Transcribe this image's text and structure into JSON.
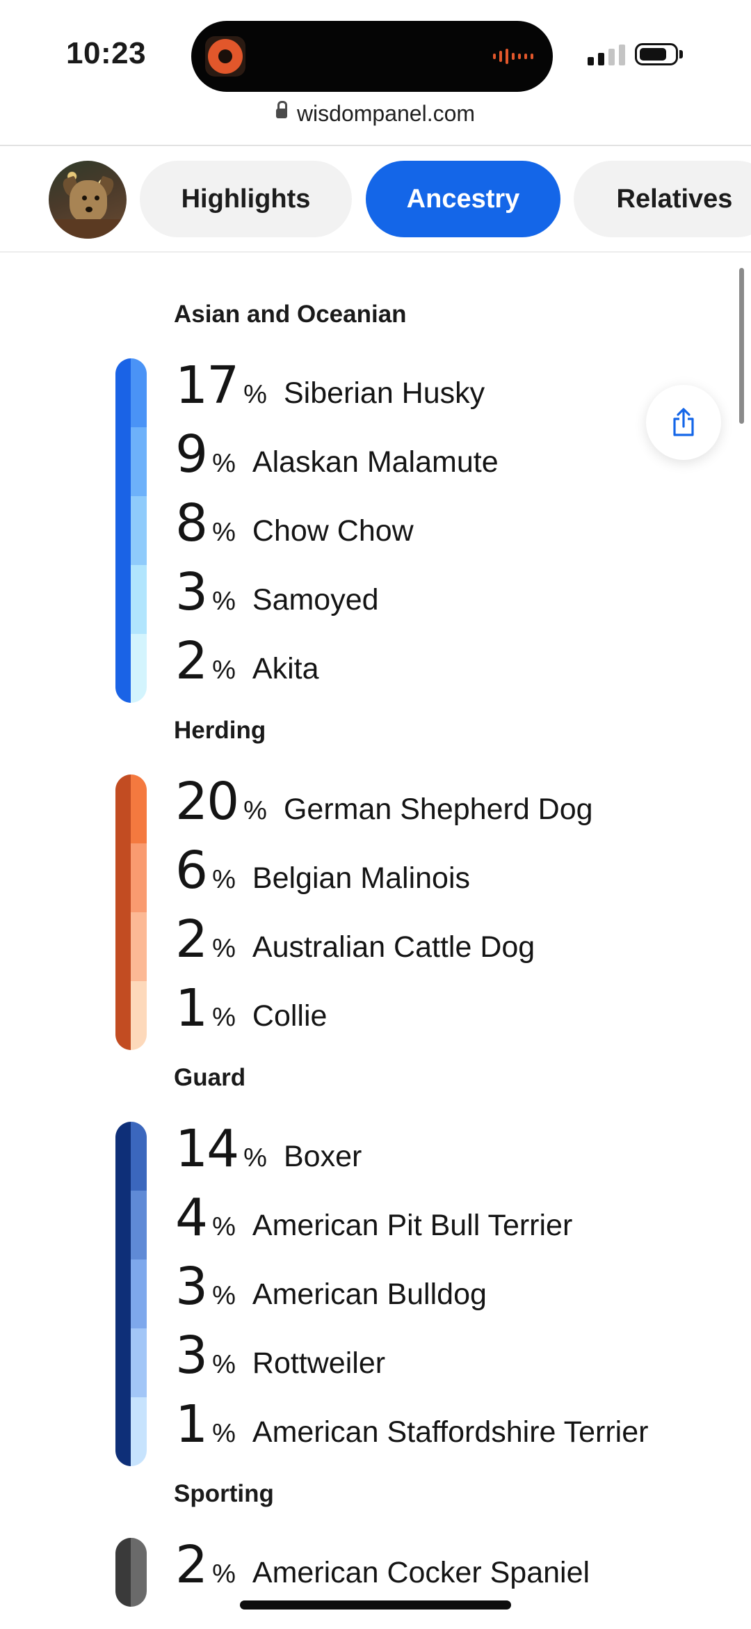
{
  "status_bar": {
    "time": "10:23"
  },
  "browser": {
    "url": "wisdompanel.com"
  },
  "tabs": [
    {
      "label": "Highlights",
      "active": false
    },
    {
      "label": "Ancestry",
      "active": true
    },
    {
      "label": "Relatives",
      "active": false
    }
  ],
  "colors": {
    "accent": "#1466e8"
  },
  "groups": [
    {
      "title": "Asian and Oceanian",
      "bar_colors": [
        [
          "#1a63e6",
          "#4a93f6"
        ],
        [
          "#1a63e6",
          "#6db1fa"
        ],
        [
          "#1a63e6",
          "#8fcbfb"
        ],
        [
          "#1a63e6",
          "#b1e5fd"
        ],
        [
          "#1a63e6",
          "#d3f4fd"
        ]
      ],
      "breeds": [
        {
          "pct": "17",
          "name": "Siberian Husky"
        },
        {
          "pct": "9",
          "name": "Alaskan Malamute"
        },
        {
          "pct": "8",
          "name": "Chow Chow"
        },
        {
          "pct": "3",
          "name": "Samoyed"
        },
        {
          "pct": "2",
          "name": "Akita"
        }
      ]
    },
    {
      "title": "Herding",
      "bar_colors": [
        [
          "#c24c22",
          "#f4793f"
        ],
        [
          "#c24c22",
          "#f99b70"
        ],
        [
          "#c24c22",
          "#fcb995"
        ],
        [
          "#c24c22",
          "#fdd9bb"
        ]
      ],
      "breeds": [
        {
          "pct": "20",
          "name": "German Shepherd Dog"
        },
        {
          "pct": "6",
          "name": "Belgian Malinois"
        },
        {
          "pct": "2",
          "name": "Australian Cattle Dog"
        },
        {
          "pct": "1",
          "name": "Collie"
        }
      ]
    },
    {
      "title": "Guard",
      "bar_colors": [
        [
          "#0e2f78",
          "#3b67bd"
        ],
        [
          "#0e2f78",
          "#5f8ad6"
        ],
        [
          "#0e2f78",
          "#7ea8ec"
        ],
        [
          "#0e2f78",
          "#a2c6f7"
        ],
        [
          "#0e2f78",
          "#c7e3fd"
        ]
      ],
      "breeds": [
        {
          "pct": "14",
          "name": "Boxer"
        },
        {
          "pct": "4",
          "name": "American Pit Bull Terrier"
        },
        {
          "pct": "3",
          "name": "American Bulldog"
        },
        {
          "pct": "3",
          "name": "Rottweiler"
        },
        {
          "pct": "1",
          "name": "American Staffordshire Terrier"
        }
      ]
    },
    {
      "title": "Sporting",
      "bar_colors": [
        [
          "#3a3a3a",
          "#6a6a6a"
        ]
      ],
      "breeds": [
        {
          "pct": "2",
          "name": "American Cocker Spaniel"
        }
      ]
    }
  ],
  "percent_symbol": "%"
}
